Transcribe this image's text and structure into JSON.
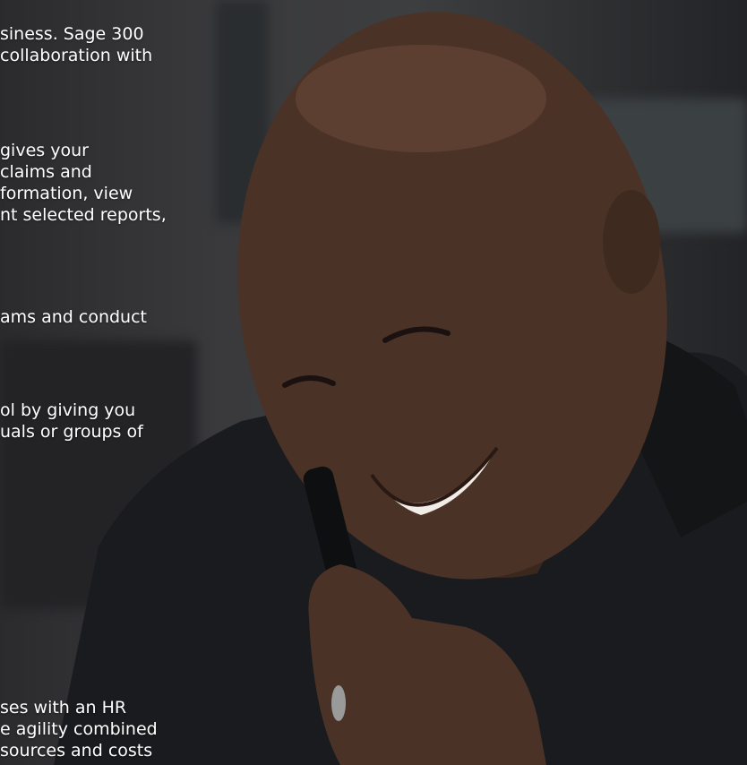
{
  "paragraphs": [
    {
      "lines": [
        "siness. Sage 300",
        "collaboration with"
      ]
    },
    {
      "lines": [
        "gives your",
        "claims and",
        "formation, view",
        "nt selected reports,"
      ]
    },
    {
      "lines": [
        "ams and conduct"
      ]
    },
    {
      "lines": [
        "ol by giving you",
        "uals or groups of"
      ]
    },
    {
      "lines": [
        "ses with an HR",
        "e agility combined",
        "sources and costs"
      ]
    }
  ],
  "colors": {
    "text": "#ffffff",
    "overlay": "#1e1f22",
    "skin": "#4a3226",
    "jacket": "#1a1b1e"
  }
}
